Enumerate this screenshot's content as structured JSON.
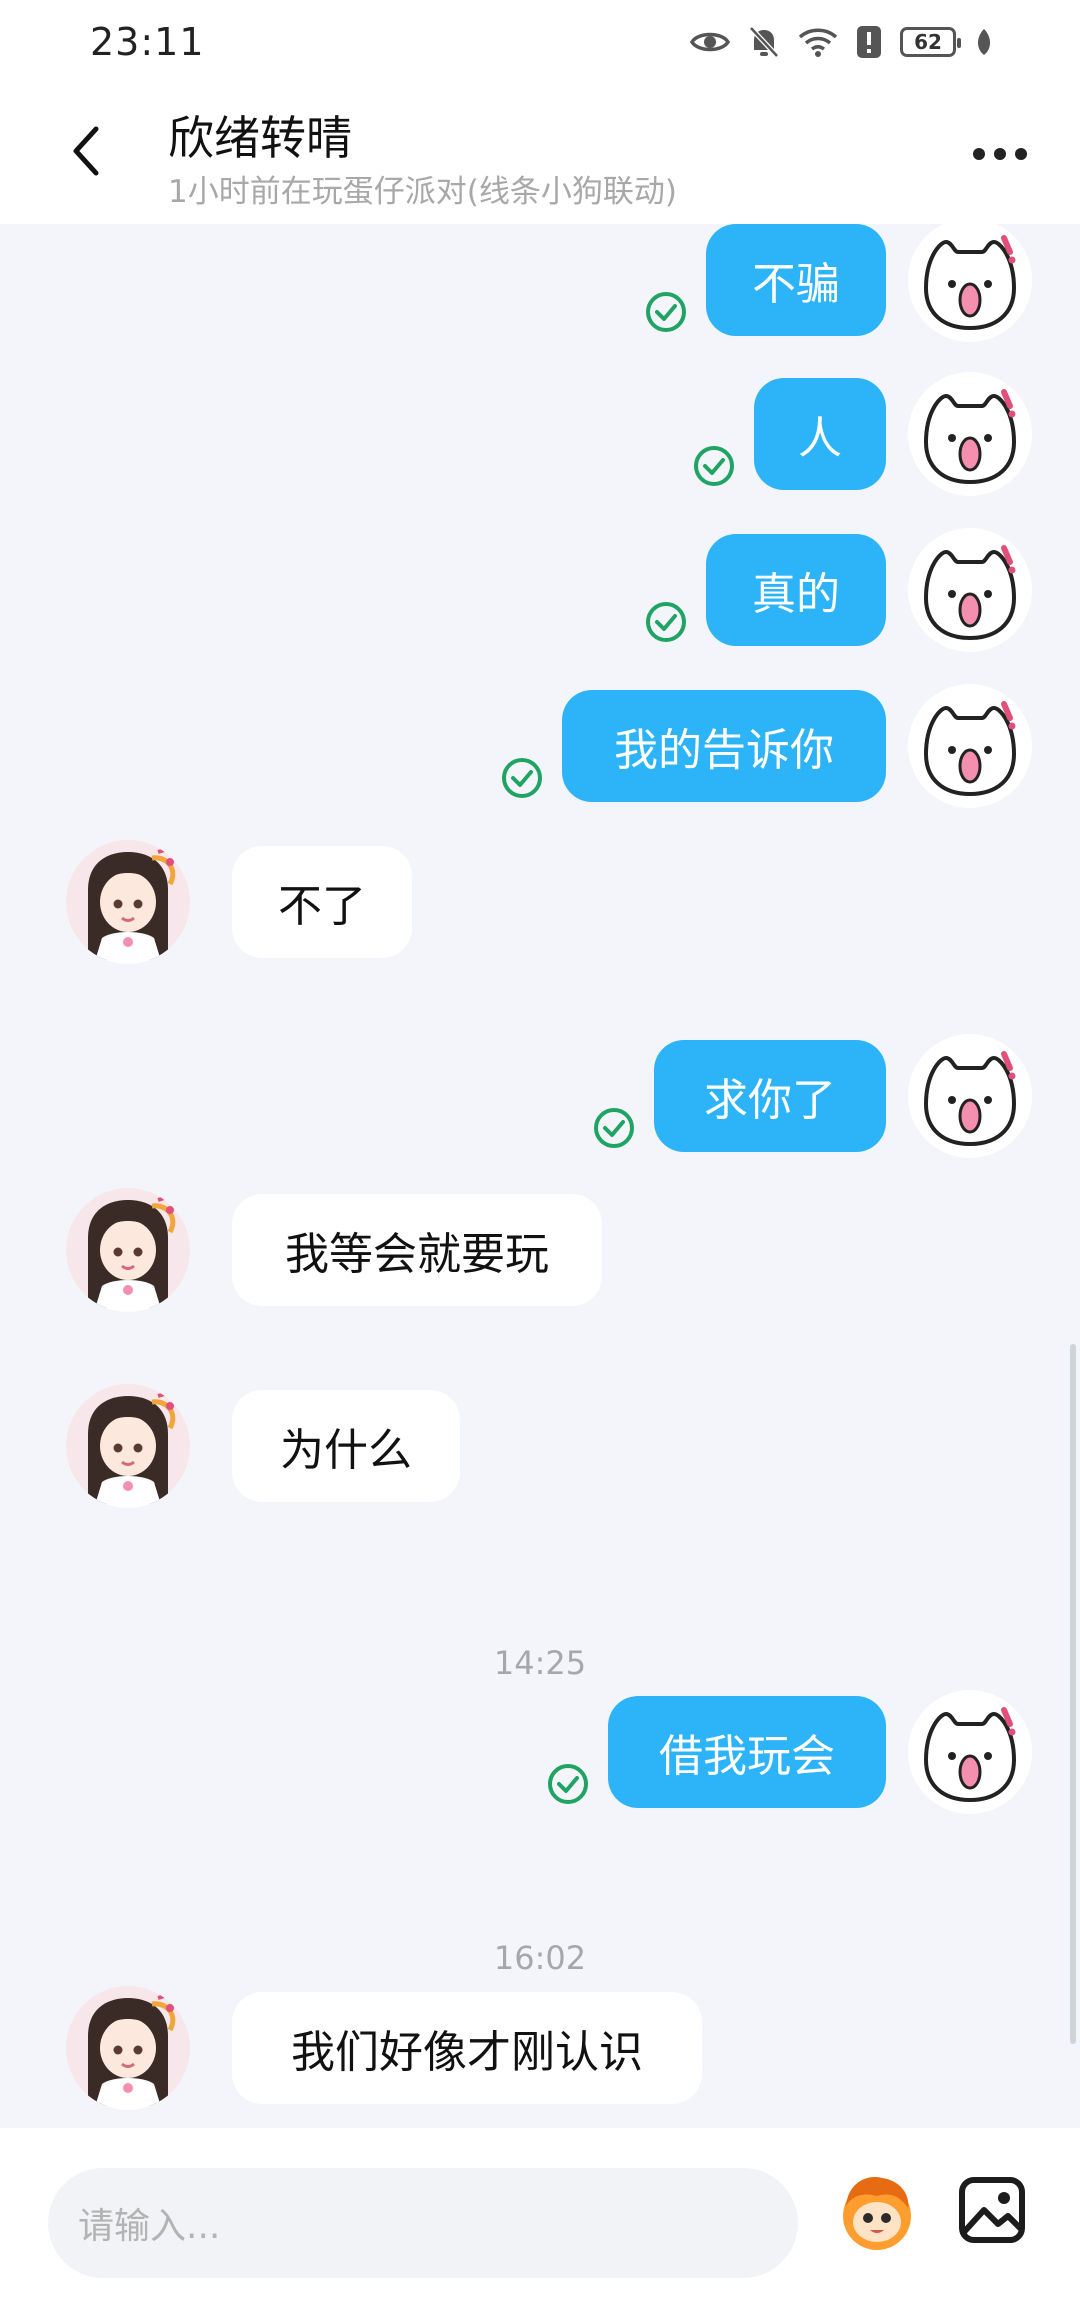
{
  "status_bar": {
    "time": "23:11",
    "battery": "62",
    "icons": [
      "eye-icon",
      "bell-muted-icon",
      "wifi-icon",
      "alert-icon",
      "battery-icon",
      "leaf-icon"
    ]
  },
  "header": {
    "title": "欣绪转晴",
    "subtitle": "1小时前在玩蛋仔派对(线条小狗联动)"
  },
  "colors": {
    "outgoing_bubble": "#2db4f8",
    "incoming_bubble": "#ffffff",
    "read_check": "#1fa463",
    "background": "#f3f5fa"
  },
  "messages": [
    {
      "direction": "out",
      "text": "不骗",
      "read": true
    },
    {
      "direction": "out",
      "text": "人",
      "read": true
    },
    {
      "direction": "out",
      "text": "真的",
      "read": true
    },
    {
      "direction": "out",
      "text": "我的告诉你",
      "read": true
    },
    {
      "direction": "in",
      "text": "不了"
    },
    {
      "direction": "out",
      "text": "求你了",
      "read": true
    },
    {
      "direction": "in",
      "text": "我等会就要玩"
    },
    {
      "direction": "in",
      "text": "为什么"
    },
    {
      "type": "timestamp",
      "text": "14:25"
    },
    {
      "direction": "out",
      "text": "借我玩会",
      "read": true
    },
    {
      "type": "timestamp",
      "text": "16:02"
    },
    {
      "direction": "in",
      "text": "我们好像才刚认识"
    }
  ],
  "input": {
    "placeholder": "请输入..."
  }
}
